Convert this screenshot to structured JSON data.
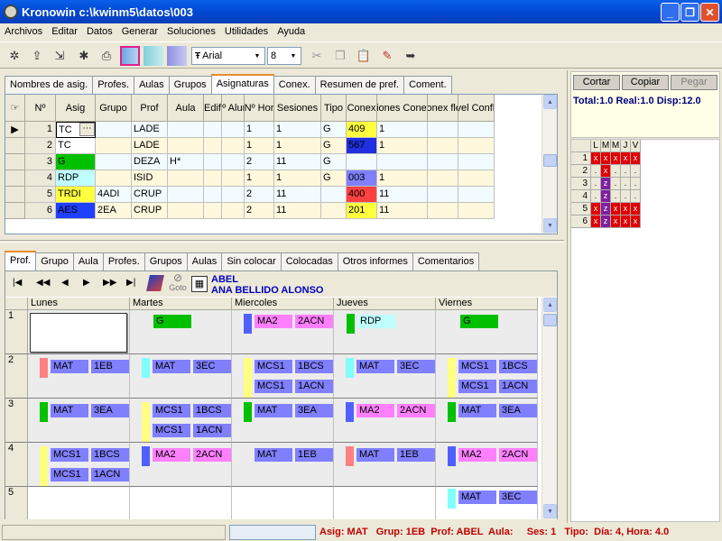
{
  "window": {
    "title": "Kronowin  c:\\kwinm5\\datos\\003"
  },
  "menu": [
    "Archivos",
    "Editar",
    "Datos",
    "Generar",
    "Soluciones",
    "Utilidades",
    "Ayuda"
  ],
  "toolbar": {
    "font_name": "Arial",
    "font_size": "8"
  },
  "top_tabs": [
    "Nombres de asig.",
    "Profes.",
    "Aulas",
    "Grupos",
    "Asignaturas",
    "Conex.",
    "Resumen de pref.",
    "Coment."
  ],
  "top_tabs_active": "Asignaturas",
  "asig_table": {
    "headers": [
      "Nº",
      "Asig",
      "Grupo",
      "Prof",
      "Aula",
      "Edif",
      "Nº Alum",
      "Nº Hor",
      "Sesiones",
      "Tipo",
      "Conex",
      "Sesiones Conexión",
      "Conex flex",
      "Nivel Conflex"
    ],
    "rows": [
      {
        "n": "1",
        "asig": "TC",
        "grupo": "",
        "prof": "LADE",
        "aula": "",
        "edif": "",
        "alum": "",
        "hor": "1",
        "ses": "1",
        "tipo": "G",
        "conex": "409",
        "sesc": "1",
        "asig_color": "#ffffff",
        "conex_color": "#ffff40"
      },
      {
        "n": "2",
        "asig": "TC",
        "grupo": "",
        "prof": "LADE",
        "aula": "",
        "edif": "",
        "alum": "",
        "hor": "1",
        "ses": "1",
        "tipo": "G",
        "conex": "567",
        "sesc": "1",
        "asig_color": "#ffffff",
        "conex_color": "#2030e0"
      },
      {
        "n": "3",
        "asig": "G",
        "grupo": "",
        "prof": "DEZA",
        "aula": "H*",
        "edif": "",
        "alum": "",
        "hor": "2",
        "ses": "11",
        "tipo": "G",
        "conex": "",
        "sesc": "",
        "asig_color": "#00c000",
        "conex_color": ""
      },
      {
        "n": "4",
        "asig": "RDP",
        "grupo": "",
        "prof": "ISID",
        "aula": "",
        "edif": "",
        "alum": "",
        "hor": "1",
        "ses": "1",
        "tipo": "G",
        "conex": "003",
        "sesc": "1",
        "asig_color": "#c0ffff",
        "conex_color": "#8080ff"
      },
      {
        "n": "5",
        "asig": "TRDI",
        "grupo": "4ADI",
        "prof": "CRUP",
        "aula": "",
        "edif": "",
        "alum": "",
        "hor": "2",
        "ses": "11",
        "tipo": "",
        "conex": "400",
        "sesc": "11",
        "asig_color": "#ffff40",
        "conex_color": "#ff4040"
      },
      {
        "n": "6",
        "asig": "AES",
        "grupo": "2EA",
        "prof": "CRUP",
        "aula": "",
        "edif": "",
        "alum": "",
        "hor": "2",
        "ses": "11",
        "tipo": "",
        "conex": "201",
        "sesc": "11",
        "asig_color": "#2040ff",
        "conex_color": "#ffff40"
      }
    ]
  },
  "right_panel": {
    "buttons": [
      "Cortar",
      "Copiar",
      "Pegar"
    ],
    "totals": "Total:1.0 Real:1.0 Disp:12.0",
    "days_header": [
      "L",
      "M",
      "M",
      "J",
      "V"
    ],
    "rows": [
      {
        "n": "1",
        "cells": [
          "x",
          "x",
          "x",
          "x",
          "x"
        ]
      },
      {
        "n": "2",
        "cells": [
          ".",
          "x",
          ".",
          ".",
          "."
        ]
      },
      {
        "n": "3",
        "cells": [
          ".",
          "z",
          ".",
          ".",
          "."
        ]
      },
      {
        "n": "4",
        "cells": [
          ".",
          "z",
          ".",
          ".",
          "."
        ]
      },
      {
        "n": "5",
        "cells": [
          "x",
          "z",
          "x",
          "x",
          "x"
        ]
      },
      {
        "n": "6",
        "cells": [
          "x",
          "z",
          "x",
          "x",
          "x"
        ]
      }
    ]
  },
  "bottom_tabs": [
    "Prof.",
    "Grupo",
    "Aula",
    "Profes.",
    "Grupos",
    "Aulas",
    "Sin colocar",
    "Colocadas",
    "Otros informes",
    "Comentarios"
  ],
  "bottom_tabs_active": "Prof.",
  "teacher": {
    "code": "ABEL",
    "name": "ANA BELLIDO ALONSO"
  },
  "goto_label": "Goto",
  "timetable": {
    "days": [
      "Lunes",
      "Martes",
      "Miercoles",
      "Jueves",
      "Viernes"
    ],
    "hours": [
      "1",
      "2",
      "3",
      "4",
      "5"
    ]
  },
  "status": {
    "text": "Asig: MAT   Grup: 1EB  Prof: ABEL  Aula:     Ses: 1   Tipo:  Día: 4, Hora: 4.0"
  }
}
